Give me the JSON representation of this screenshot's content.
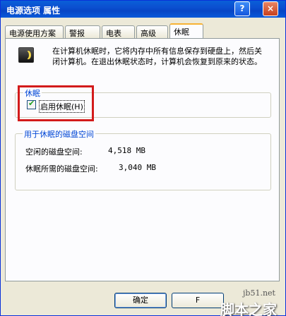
{
  "window": {
    "title": "电源选项 属性",
    "help_glyph": "?",
    "close_glyph": "×"
  },
  "tabs": [
    {
      "label": "电源使用方案",
      "active": false
    },
    {
      "label": "警报",
      "active": false
    },
    {
      "label": "电表",
      "active": false
    },
    {
      "label": "高级",
      "active": false
    },
    {
      "label": "休眠",
      "active": true
    }
  ],
  "hibernate_tab": {
    "icon": "hibernate-monitor-icon",
    "description": "在计算机休眠时，它将内存中所有信息保存到硬盘上，然后关闭计算机。在退出休眠状态时，计算机会恢复到原来的状态。",
    "group_hibernate": {
      "title": "休眠",
      "checkbox_label": "启用休眠(H)",
      "checked": true
    },
    "group_disk": {
      "title": "用于休眠的磁盘空间",
      "free_label": "空闲的磁盘空间:",
      "free_value": "4,518 MB",
      "required_label": "休眠所需的磁盘空间:",
      "required_value": "3,040 MB"
    }
  },
  "buttons": {
    "ok": "确定",
    "cancel": "F"
  },
  "watermark": {
    "url": "jb51.net",
    "text": "脚本之家"
  },
  "colors": {
    "titlebar": "#0a5fd8",
    "highlight_box": "#d31b1b",
    "group_title": "#0046d5"
  }
}
